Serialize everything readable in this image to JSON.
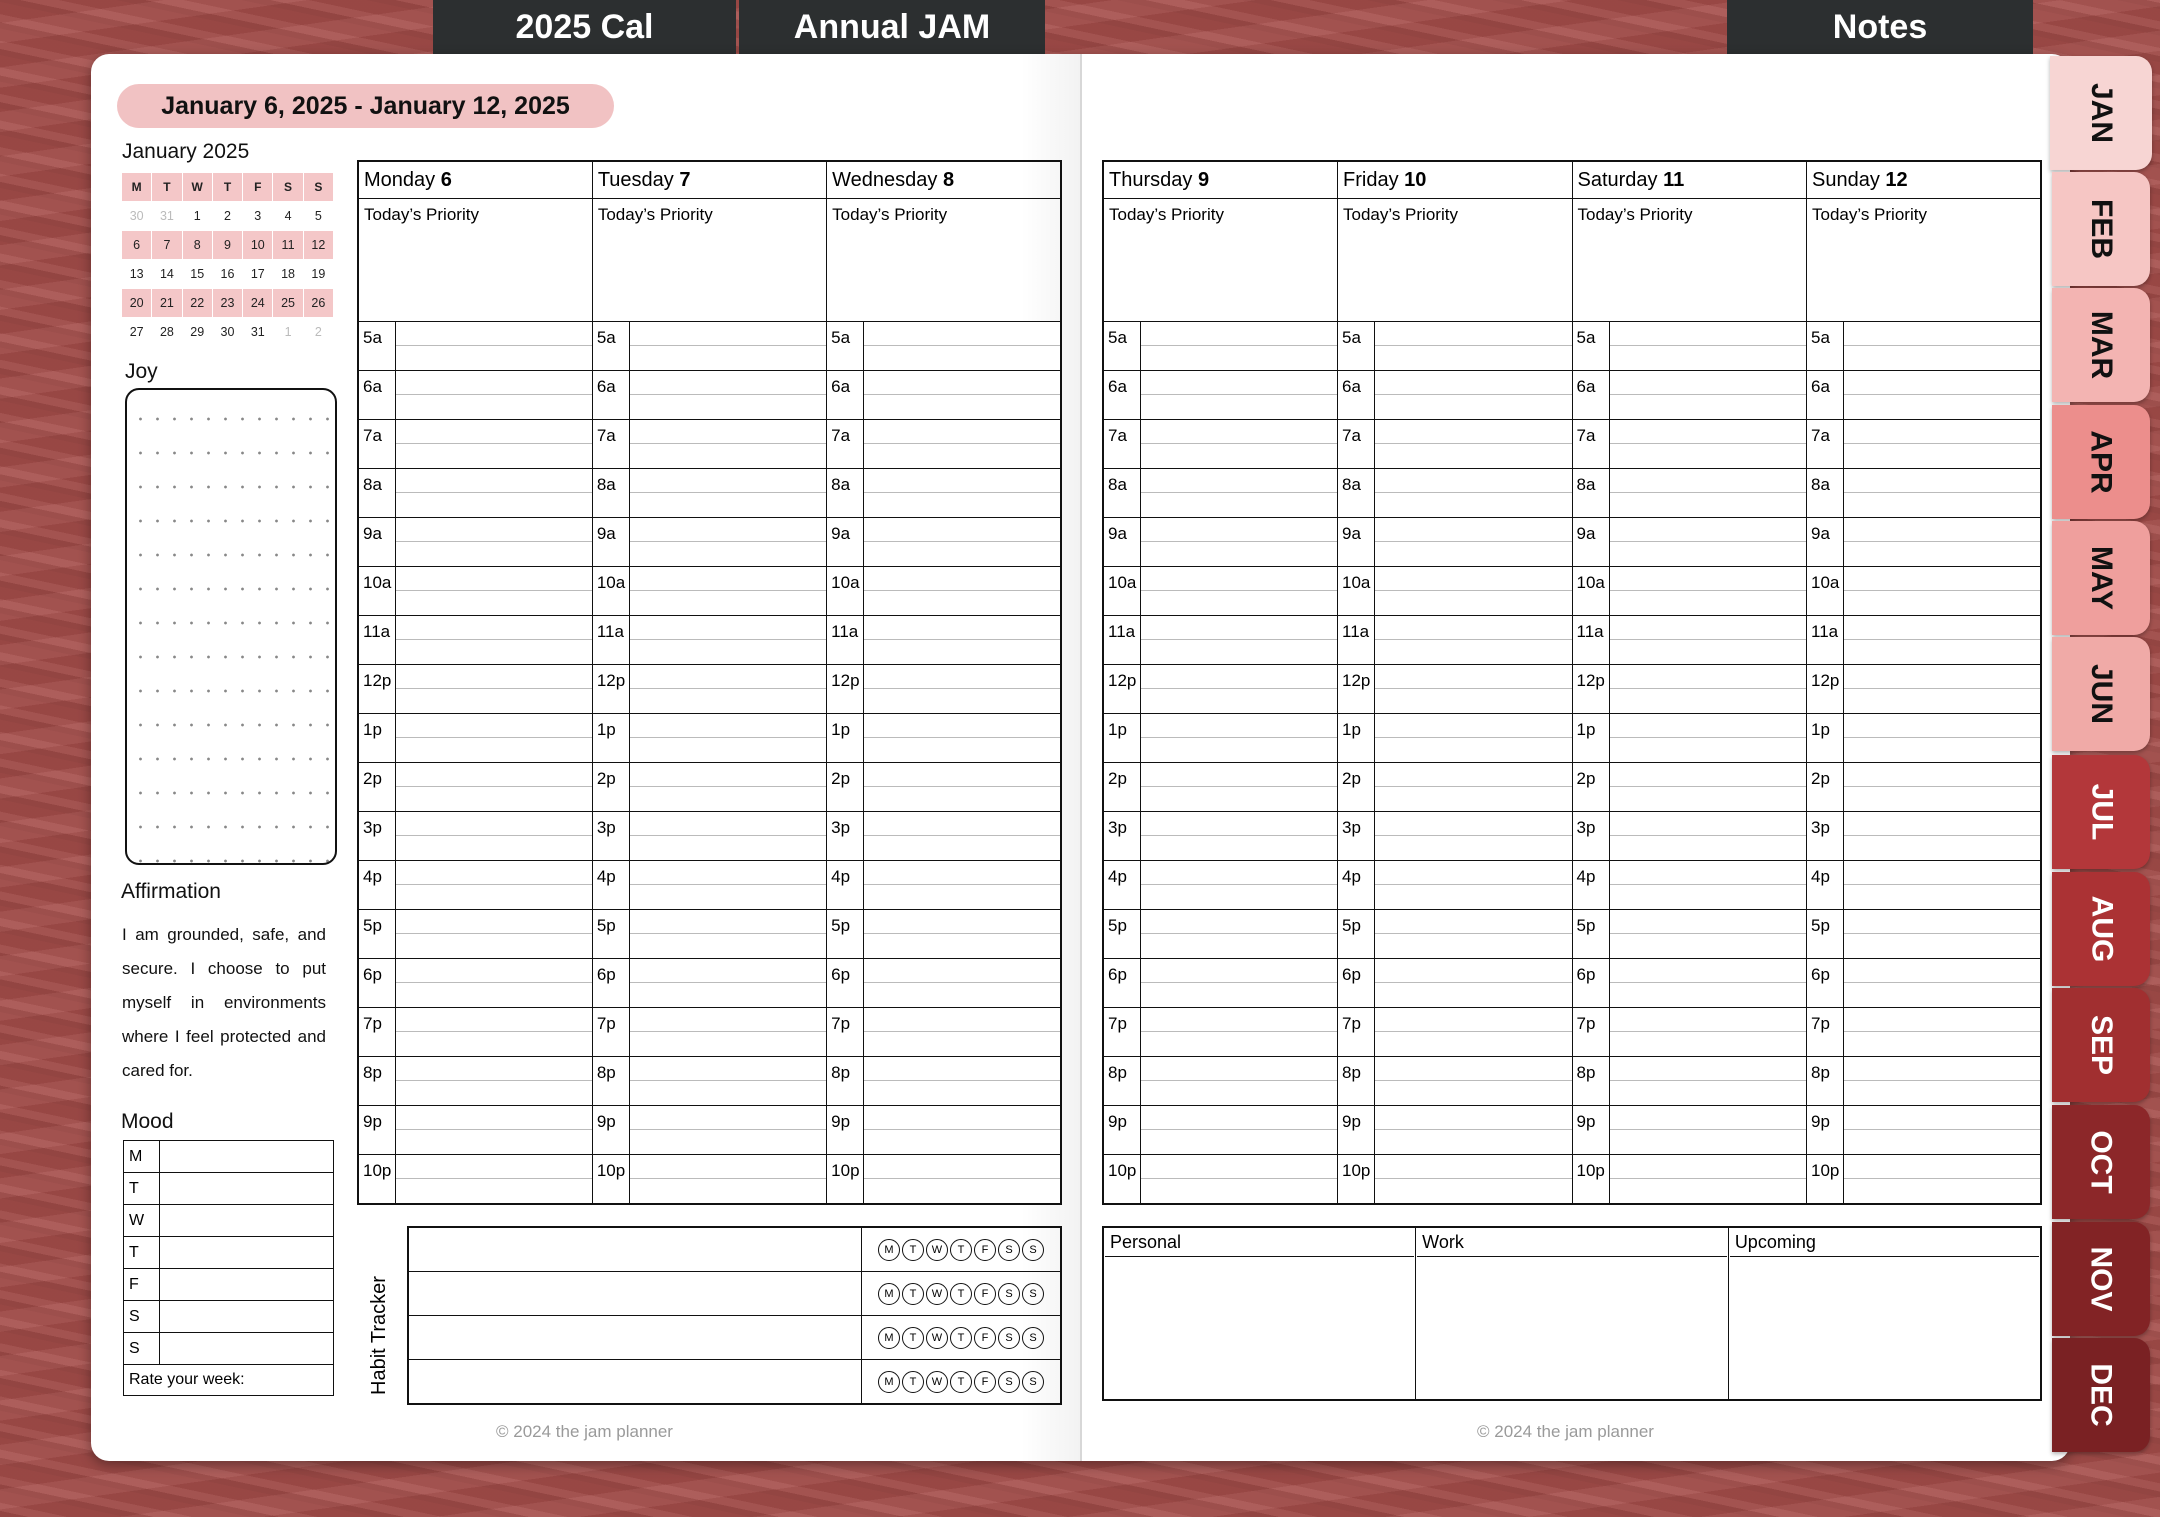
{
  "top_tabs": [
    "2025 Cal",
    "Annual JAM",
    "Notes"
  ],
  "week_range": "January 6, 2025 - January 12, 2025",
  "mini_calendar": {
    "title": "January 2025",
    "headers": [
      "M",
      "T",
      "W",
      "T",
      "F",
      "S",
      "S"
    ],
    "rows": [
      [
        "30",
        "31",
        "1",
        "2",
        "3",
        "4",
        "5"
      ],
      [
        "6",
        "7",
        "8",
        "9",
        "10",
        "11",
        "12"
      ],
      [
        "13",
        "14",
        "15",
        "16",
        "17",
        "18",
        "19"
      ],
      [
        "20",
        "21",
        "22",
        "23",
        "24",
        "25",
        "26"
      ],
      [
        "27",
        "28",
        "29",
        "30",
        "31",
        "1",
        "2"
      ]
    ]
  },
  "joy_label": "Joy",
  "affirmation": {
    "title": "Affirmation",
    "text": "I am grounded, safe, and secure. I choose to put myself in environments where I feel protected and cared for."
  },
  "mood": {
    "title": "Mood",
    "days": [
      "M",
      "T",
      "W",
      "T",
      "F",
      "S",
      "S"
    ],
    "rate_label": "Rate your week:"
  },
  "priority_label": "Today’s Priority",
  "hours": [
    "5a",
    "6a",
    "7a",
    "8a",
    "9a",
    "10a",
    "11a",
    "12p",
    "1p",
    "2p",
    "3p",
    "4p",
    "5p",
    "6p",
    "7p",
    "8p",
    "9p",
    "10p"
  ],
  "left_days": [
    {
      "name": "Monday",
      "num": "6"
    },
    {
      "name": "Tuesday",
      "num": "7"
    },
    {
      "name": "Wednesday",
      "num": "8"
    }
  ],
  "right_days": [
    {
      "name": "Thursday",
      "num": "9"
    },
    {
      "name": "Friday",
      "num": "10"
    },
    {
      "name": "Saturday",
      "num": "11"
    },
    {
      "name": "Sunday",
      "num": "12"
    }
  ],
  "habit_tracker": {
    "label": "Habit Tracker",
    "day_letters": [
      "M",
      "T",
      "W",
      "T",
      "F",
      "S",
      "S"
    ],
    "rows": 4
  },
  "notes_sections": [
    "Personal",
    "Work",
    "Upcoming"
  ],
  "copyright": "© 2024 the jam planner",
  "month_tabs": [
    {
      "label": "JAN",
      "color": "#f7d5d3"
    },
    {
      "label": "FEB",
      "color": "#f6c6c4"
    },
    {
      "label": "MAR",
      "color": "#f3b4b2"
    },
    {
      "label": "APR",
      "color": "#ec8e8c"
    },
    {
      "label": "MAY",
      "color": "#ef9f9d"
    },
    {
      "label": "JUN",
      "color": "#f0aaa7"
    },
    {
      "label": "JUL",
      "color": "#b3373a"
    },
    {
      "label": "AUG",
      "color": "#ab3234"
    },
    {
      "label": "SEP",
      "color": "#a12f30"
    },
    {
      "label": "OCT",
      "color": "#8c2729"
    },
    {
      "label": "NOV",
      "color": "#822325"
    },
    {
      "label": "DEC",
      "color": "#7a2123"
    }
  ]
}
